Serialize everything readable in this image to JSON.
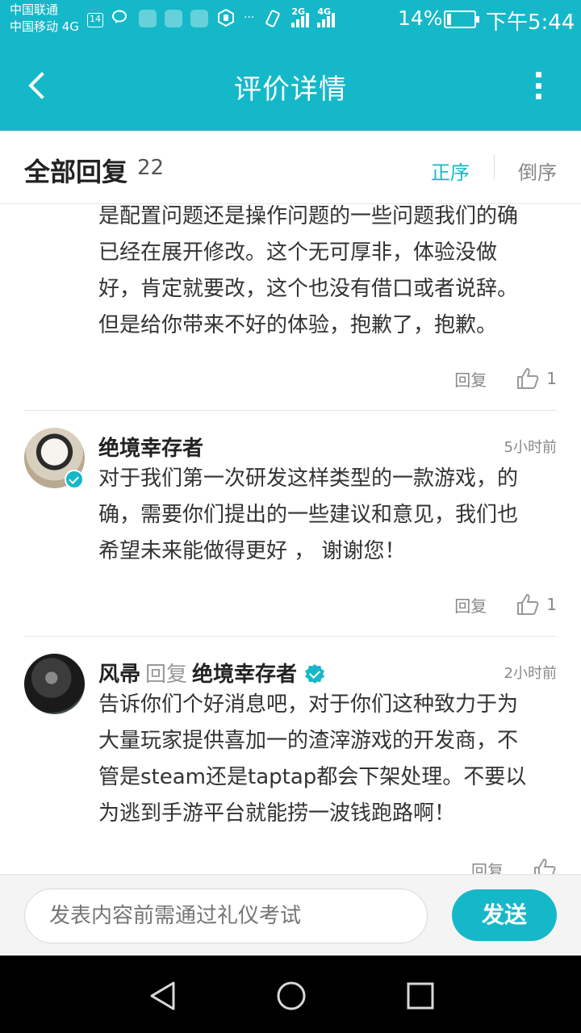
{
  "status_bar": {
    "carrier1": "中国联通",
    "carrier2": "中国移动 4G",
    "notif_count": "14",
    "ellipsis": "···",
    "net1": "2G",
    "net2": "4G",
    "battery": "14%",
    "time": "下午5:44"
  },
  "header": {
    "title": "评价详情"
  },
  "sort_bar": {
    "label": "全部回复",
    "count": "22",
    "asc": "正序",
    "desc": "倒序"
  },
  "comments": [
    {
      "lines": [
        "是配置问题还是操作问题的一些问题我们的确",
        "已经在展开修改。这个无可厚非，体验没做",
        "好，肯定就要改，这个也没有借口或者说辞。",
        "但是给你带来不好的体验，抱歉了，抱歉。"
      ],
      "reply_label": "回复",
      "likes": "1"
    },
    {
      "author": "绝境幸存者",
      "time": "5小时前",
      "lines": [
        "对于我们第一次研发这样类型的一款游戏，的",
        "确，需要你们提出的一些建议和意见，我们也",
        "希望未来能做得更好 ， 谢谢您！"
      ],
      "reply_label": "回复",
      "likes": "1"
    },
    {
      "author": "风帚",
      "reply_word": "回复",
      "reply_to": "绝境幸存者",
      "time": "2小时前",
      "lines": [
        "告诉你们个好消息吧，对于你们这种致力于为",
        "大量玩家提供喜加一的渣滓游戏的开发商，不",
        "管是steam还是taptap都会下架处理。不要以",
        "为逃到手游平台就能捞一波钱跑路啊！"
      ],
      "reply_label": "回复"
    }
  ],
  "composer": {
    "placeholder": "发表内容前需通过礼仪考试",
    "send": "发送"
  },
  "colors": {
    "accent": "#15b8c8"
  }
}
